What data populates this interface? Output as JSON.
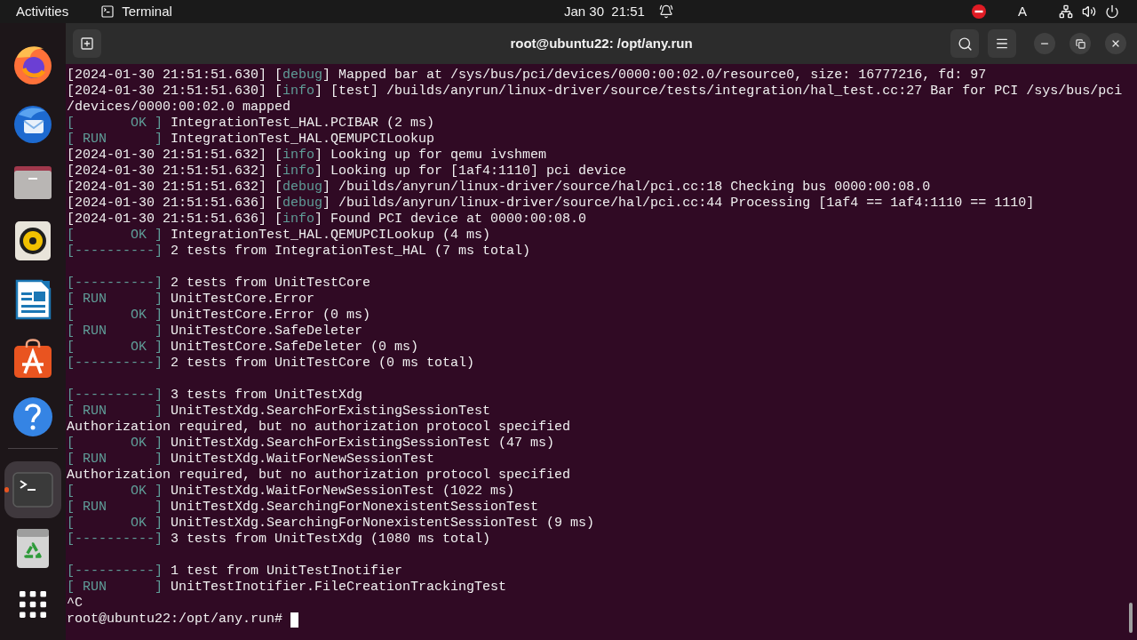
{
  "top_bar": {
    "activities": "Activities",
    "app_menu": "Terminal",
    "clock": "Jan 30  21:51",
    "input_source": "A"
  },
  "dock": {
    "groups": [
      {
        "apps": [
          {
            "kind": "fox",
            "selected": false,
            "running": false
          },
          {
            "kind": "bird",
            "selected": false,
            "running": false
          },
          {
            "kind": "folder",
            "selected": false,
            "running": false
          },
          {
            "kind": "speaker",
            "selected": false,
            "running": false
          },
          {
            "kind": "document",
            "selected": false,
            "running": false
          },
          {
            "kind": "bag",
            "selected": false,
            "running": false
          },
          {
            "kind": "help",
            "selected": false,
            "running": false
          }
        ]
      },
      {
        "apps": [
          {
            "kind": "terminal",
            "selected": true,
            "running": true
          },
          {
            "kind": "trash",
            "selected": false,
            "running": false
          }
        ]
      }
    ]
  },
  "terminal": {
    "title": "root@ubuntu22: /opt/any.run",
    "lines": [
      {
        "kind": "output",
        "segments": [
          {
            "text": "[2024-01-30 21:51:51.630] [",
            "kind": "plain"
          },
          {
            "text": "debug",
            "kind": "tag"
          },
          {
            "text": "] Mapped bar at /sys/bus/pci/devices/0000:00:02.0/resource0, size: 16777216, fd: 97",
            "kind": "plain"
          }
        ]
      },
      {
        "kind": "output",
        "segments": [
          {
            "text": "[2024-01-30 21:51:51.630] [",
            "kind": "plain"
          },
          {
            "text": "info",
            "kind": "tag"
          },
          {
            "text": "] [test] /builds/anyrun/linux-driver/source/tests/integration/hal_test.cc:27 Bar for PCI /sys/bus/pci",
            "kind": "plain"
          }
        ]
      },
      {
        "kind": "output",
        "segments": [
          {
            "text": "/devices/0000:00:02.0 mapped",
            "kind": "plain"
          }
        ]
      },
      {
        "kind": "output",
        "segments": [
          {
            "text": "[       OK ]",
            "kind": "tag"
          },
          {
            "text": " IntegrationTest_HAL.PCIBAR (2 ms)",
            "kind": "plain"
          }
        ]
      },
      {
        "kind": "output",
        "segments": [
          {
            "text": "[ RUN      ]",
            "kind": "tag"
          },
          {
            "text": " IntegrationTest_HAL.QEMUPCILookup",
            "kind": "plain"
          }
        ]
      },
      {
        "kind": "output",
        "segments": [
          {
            "text": "[2024-01-30 21:51:51.632] [",
            "kind": "plain"
          },
          {
            "text": "info",
            "kind": "tag"
          },
          {
            "text": "] Looking up for qemu ivshmem",
            "kind": "plain"
          }
        ]
      },
      {
        "kind": "output",
        "segments": [
          {
            "text": "[2024-01-30 21:51:51.632] [",
            "kind": "plain"
          },
          {
            "text": "info",
            "kind": "tag"
          },
          {
            "text": "] Looking up for [1af4:1110] pci device",
            "kind": "plain"
          }
        ]
      },
      {
        "kind": "output",
        "segments": [
          {
            "text": "[2024-01-30 21:51:51.632] [",
            "kind": "plain"
          },
          {
            "text": "debug",
            "kind": "tag"
          },
          {
            "text": "] /builds/anyrun/linux-driver/source/hal/pci.cc:18 Checking bus 0000:00:08.0",
            "kind": "plain"
          }
        ]
      },
      {
        "kind": "output",
        "segments": [
          {
            "text": "[2024-01-30 21:51:51.636] [",
            "kind": "plain"
          },
          {
            "text": "debug",
            "kind": "tag"
          },
          {
            "text": "] /builds/anyrun/linux-driver/source/hal/pci.cc:44 Processing [1af4 == 1af4:1110 == 1110]",
            "kind": "plain"
          }
        ]
      },
      {
        "kind": "output",
        "segments": [
          {
            "text": "[2024-01-30 21:51:51.636] [",
            "kind": "plain"
          },
          {
            "text": "info",
            "kind": "tag"
          },
          {
            "text": "] Found PCI device at 0000:00:08.0",
            "kind": "plain"
          }
        ]
      },
      {
        "kind": "output",
        "segments": [
          {
            "text": "[       OK ]",
            "kind": "tag"
          },
          {
            "text": " IntegrationTest_HAL.QEMUPCILookup (4 ms)",
            "kind": "plain"
          }
        ]
      },
      {
        "kind": "output",
        "segments": [
          {
            "text": "[----------]",
            "kind": "tag"
          },
          {
            "text": " 2 tests from IntegrationTest_HAL (7 ms total)",
            "kind": "plain"
          }
        ]
      },
      {
        "kind": "blank"
      },
      {
        "kind": "output",
        "segments": [
          {
            "text": "[----------]",
            "kind": "tag"
          },
          {
            "text": " 2 tests from UnitTestCore",
            "kind": "plain"
          }
        ]
      },
      {
        "kind": "output",
        "segments": [
          {
            "text": "[ RUN      ]",
            "kind": "tag"
          },
          {
            "text": " UnitTestCore.Error",
            "kind": "plain"
          }
        ]
      },
      {
        "kind": "output",
        "segments": [
          {
            "text": "[       OK ]",
            "kind": "tag"
          },
          {
            "text": " UnitTestCore.Error (0 ms)",
            "kind": "plain"
          }
        ]
      },
      {
        "kind": "output",
        "segments": [
          {
            "text": "[ RUN      ]",
            "kind": "tag"
          },
          {
            "text": " UnitTestCore.SafeDeleter",
            "kind": "plain"
          }
        ]
      },
      {
        "kind": "output",
        "segments": [
          {
            "text": "[       OK ]",
            "kind": "tag"
          },
          {
            "text": " UnitTestCore.SafeDeleter (0 ms)",
            "kind": "plain"
          }
        ]
      },
      {
        "kind": "output",
        "segments": [
          {
            "text": "[----------]",
            "kind": "tag"
          },
          {
            "text": " 2 tests from UnitTestCore (0 ms total)",
            "kind": "plain"
          }
        ]
      },
      {
        "kind": "blank"
      },
      {
        "kind": "output",
        "segments": [
          {
            "text": "[----------]",
            "kind": "tag"
          },
          {
            "text": " 3 tests from UnitTestXdg",
            "kind": "plain"
          }
        ]
      },
      {
        "kind": "output",
        "segments": [
          {
            "text": "[ RUN      ]",
            "kind": "tag"
          },
          {
            "text": " UnitTestXdg.SearchForExistingSessionTest",
            "kind": "plain"
          }
        ]
      },
      {
        "kind": "output",
        "segments": [
          {
            "text": "Authorization required, but no authorization protocol specified",
            "kind": "plain"
          }
        ]
      },
      {
        "kind": "output",
        "segments": [
          {
            "text": "[       OK ]",
            "kind": "tag"
          },
          {
            "text": " UnitTestXdg.SearchForExistingSessionTest (47 ms)",
            "kind": "plain"
          }
        ]
      },
      {
        "kind": "output",
        "segments": [
          {
            "text": "[ RUN      ]",
            "kind": "tag"
          },
          {
            "text": " UnitTestXdg.WaitForNewSessionTest",
            "kind": "plain"
          }
        ]
      },
      {
        "kind": "output",
        "segments": [
          {
            "text": "Authorization required, but no authorization protocol specified",
            "kind": "plain"
          }
        ]
      },
      {
        "kind": "output",
        "segments": [
          {
            "text": "[       OK ]",
            "kind": "tag"
          },
          {
            "text": " UnitTestXdg.WaitForNewSessionTest (1022 ms)",
            "kind": "plain"
          }
        ]
      },
      {
        "kind": "output",
        "segments": [
          {
            "text": "[ RUN      ]",
            "kind": "tag"
          },
          {
            "text": " UnitTestXdg.SearchingForNonexistentSessionTest",
            "kind": "plain"
          }
        ]
      },
      {
        "kind": "output",
        "segments": [
          {
            "text": "[       OK ]",
            "kind": "tag"
          },
          {
            "text": " UnitTestXdg.SearchingForNonexistentSessionTest (9 ms)",
            "kind": "plain"
          }
        ]
      },
      {
        "kind": "output",
        "segments": [
          {
            "text": "[----------]",
            "kind": "tag"
          },
          {
            "text": " 3 tests from UnitTestXdg (1080 ms total)",
            "kind": "plain"
          }
        ]
      },
      {
        "kind": "blank"
      },
      {
        "kind": "output",
        "segments": [
          {
            "text": "[----------]",
            "kind": "tag"
          },
          {
            "text": " 1 test from UnitTestInotifier",
            "kind": "plain"
          }
        ]
      },
      {
        "kind": "output",
        "segments": [
          {
            "text": "[ RUN      ]",
            "kind": "tag"
          },
          {
            "text": " UnitTestInotifier.FileCreationTrackingTest",
            "kind": "plain"
          }
        ]
      },
      {
        "kind": "output",
        "segments": [
          {
            "text": "^C",
            "kind": "plain"
          }
        ]
      },
      {
        "kind": "prompt",
        "text": "root@ubuntu22:/opt/any.run#",
        "cursor": true
      }
    ]
  }
}
